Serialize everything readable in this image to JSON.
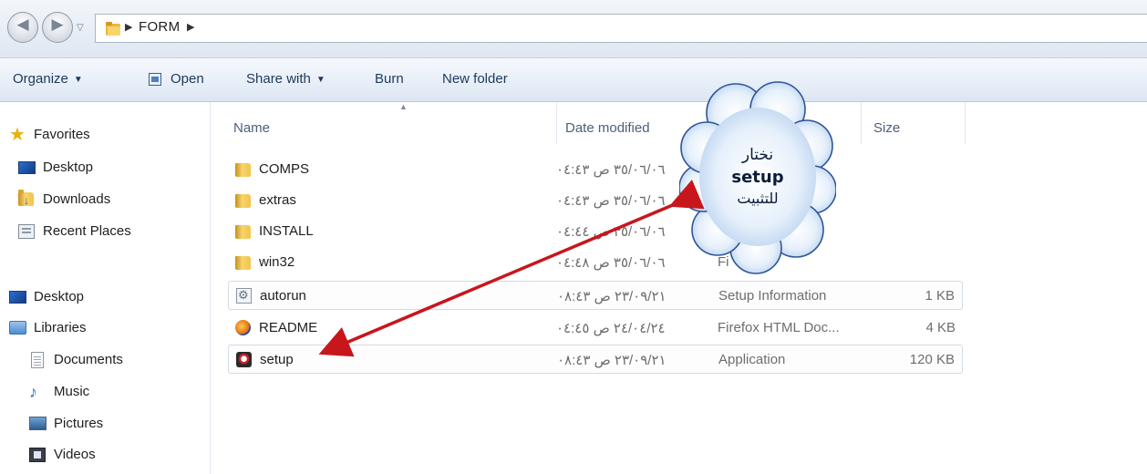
{
  "address": {
    "back_glyph": "◀",
    "forward_glyph": "▶",
    "history_glyph": "▽",
    "path_separator": "▶",
    "current_folder": "FORM",
    "trailing_separator": "▶"
  },
  "toolbar": {
    "organize": "Organize",
    "open": "Open",
    "share_with": "Share with",
    "burn": "Burn",
    "new_folder": "New folder",
    "caret": "▼"
  },
  "sidebar": {
    "items": [
      {
        "label": "Favorites",
        "icon": "star-icon"
      },
      {
        "label": "Desktop",
        "icon": "desktop-icon"
      },
      {
        "label": "Downloads",
        "icon": "downloads-folder-icon"
      },
      {
        "label": "Recent Places",
        "icon": "recent-places-icon"
      },
      {
        "label": "Desktop",
        "icon": "desktop-icon"
      },
      {
        "label": "Libraries",
        "icon": "libraries-icon"
      },
      {
        "label": "Documents",
        "icon": "documents-icon"
      },
      {
        "label": "Music",
        "icon": "music-icon"
      },
      {
        "label": "Pictures",
        "icon": "pictures-icon"
      },
      {
        "label": "Videos",
        "icon": "videos-icon"
      }
    ]
  },
  "columns": {
    "name": "Name",
    "date_modified": "Date modified",
    "size": "Size",
    "sort_glyph": "▲"
  },
  "files": [
    {
      "name": "COMPS",
      "date": "٣٥/٠٦/٠٦ ص ٠٤:٤٣",
      "type": "",
      "size": "",
      "icon": "folder-icon"
    },
    {
      "name": "extras",
      "date": "٣٥/٠٦/٠٦ ص ٠٤:٤٣",
      "type": "",
      "size": "",
      "icon": "folder-icon"
    },
    {
      "name": "INSTALL",
      "date": "٣٥/٠٦/٠٦ ص ٠٤:٤٤",
      "type": "",
      "size": "",
      "icon": "folder-icon"
    },
    {
      "name": "win32",
      "date": "٣٥/٠٦/٠٦ ص ٠٤:٤٨",
      "type": "Fi",
      "size": "",
      "icon": "folder-icon"
    },
    {
      "name": "autorun",
      "date": "٢٣/٠٩/٢١ ص ٠٨:٤٣",
      "type": "Setup Information",
      "size": "1 KB",
      "icon": "setup-information-icon"
    },
    {
      "name": "README",
      "date": "٢٤/٠٤/٢٤ ص ٠٤:٤٥",
      "type": "Firefox HTML Doc...",
      "size": "4 KB",
      "icon": "firefox-html-icon"
    },
    {
      "name": "setup",
      "date": "٢٣/٠٩/٢١ ص ٠٨:٤٣",
      "type": "Application",
      "size": "120 KB",
      "icon": "application-icon"
    }
  ],
  "callout": {
    "line1": "نختار",
    "line2": "setup",
    "line3": "للتثبيت"
  },
  "colors": {
    "arrow": "#c8161d",
    "cloud_border": "#2f5597",
    "cloud_fill_center": "#ffffff",
    "cloud_fill_edge": "#bcd4f0"
  }
}
